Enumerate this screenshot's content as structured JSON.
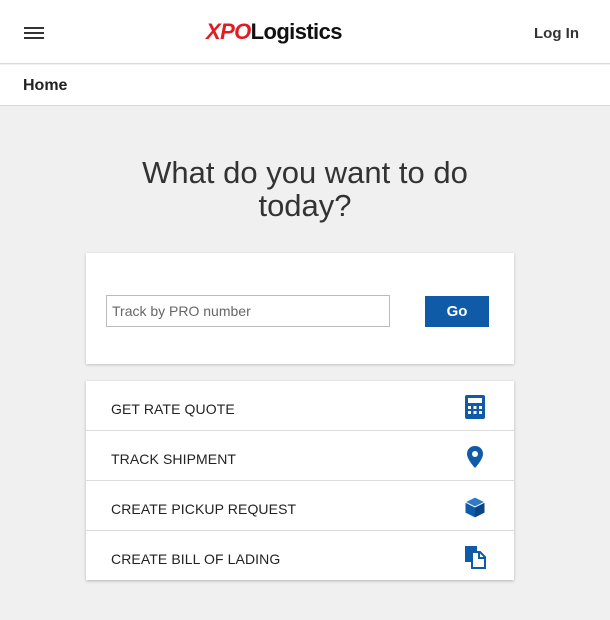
{
  "header": {
    "menu_icon": "hamburger-menu-icon",
    "logo_xpo": "XPO",
    "logo_logistics": "Logistics",
    "login_label": "Log In"
  },
  "breadcrumb": {
    "home": "Home"
  },
  "main": {
    "headline_line1": "What do you want to do",
    "headline_line2": "today?"
  },
  "track": {
    "placeholder": "Track by PRO number",
    "value": "",
    "go_label": "Go"
  },
  "actions": [
    {
      "label": "GET RATE QUOTE",
      "icon": "calculator-icon"
    },
    {
      "label": "TRACK SHIPMENT",
      "icon": "map-pin-icon"
    },
    {
      "label": "CREATE PICKUP REQUEST",
      "icon": "box-icon"
    },
    {
      "label": "CREATE BILL OF LADING",
      "icon": "documents-icon"
    }
  ],
  "colors": {
    "brand_red": "#e31b23",
    "brand_blue": "#0f5ba8",
    "page_background": "#f0f0f0"
  }
}
